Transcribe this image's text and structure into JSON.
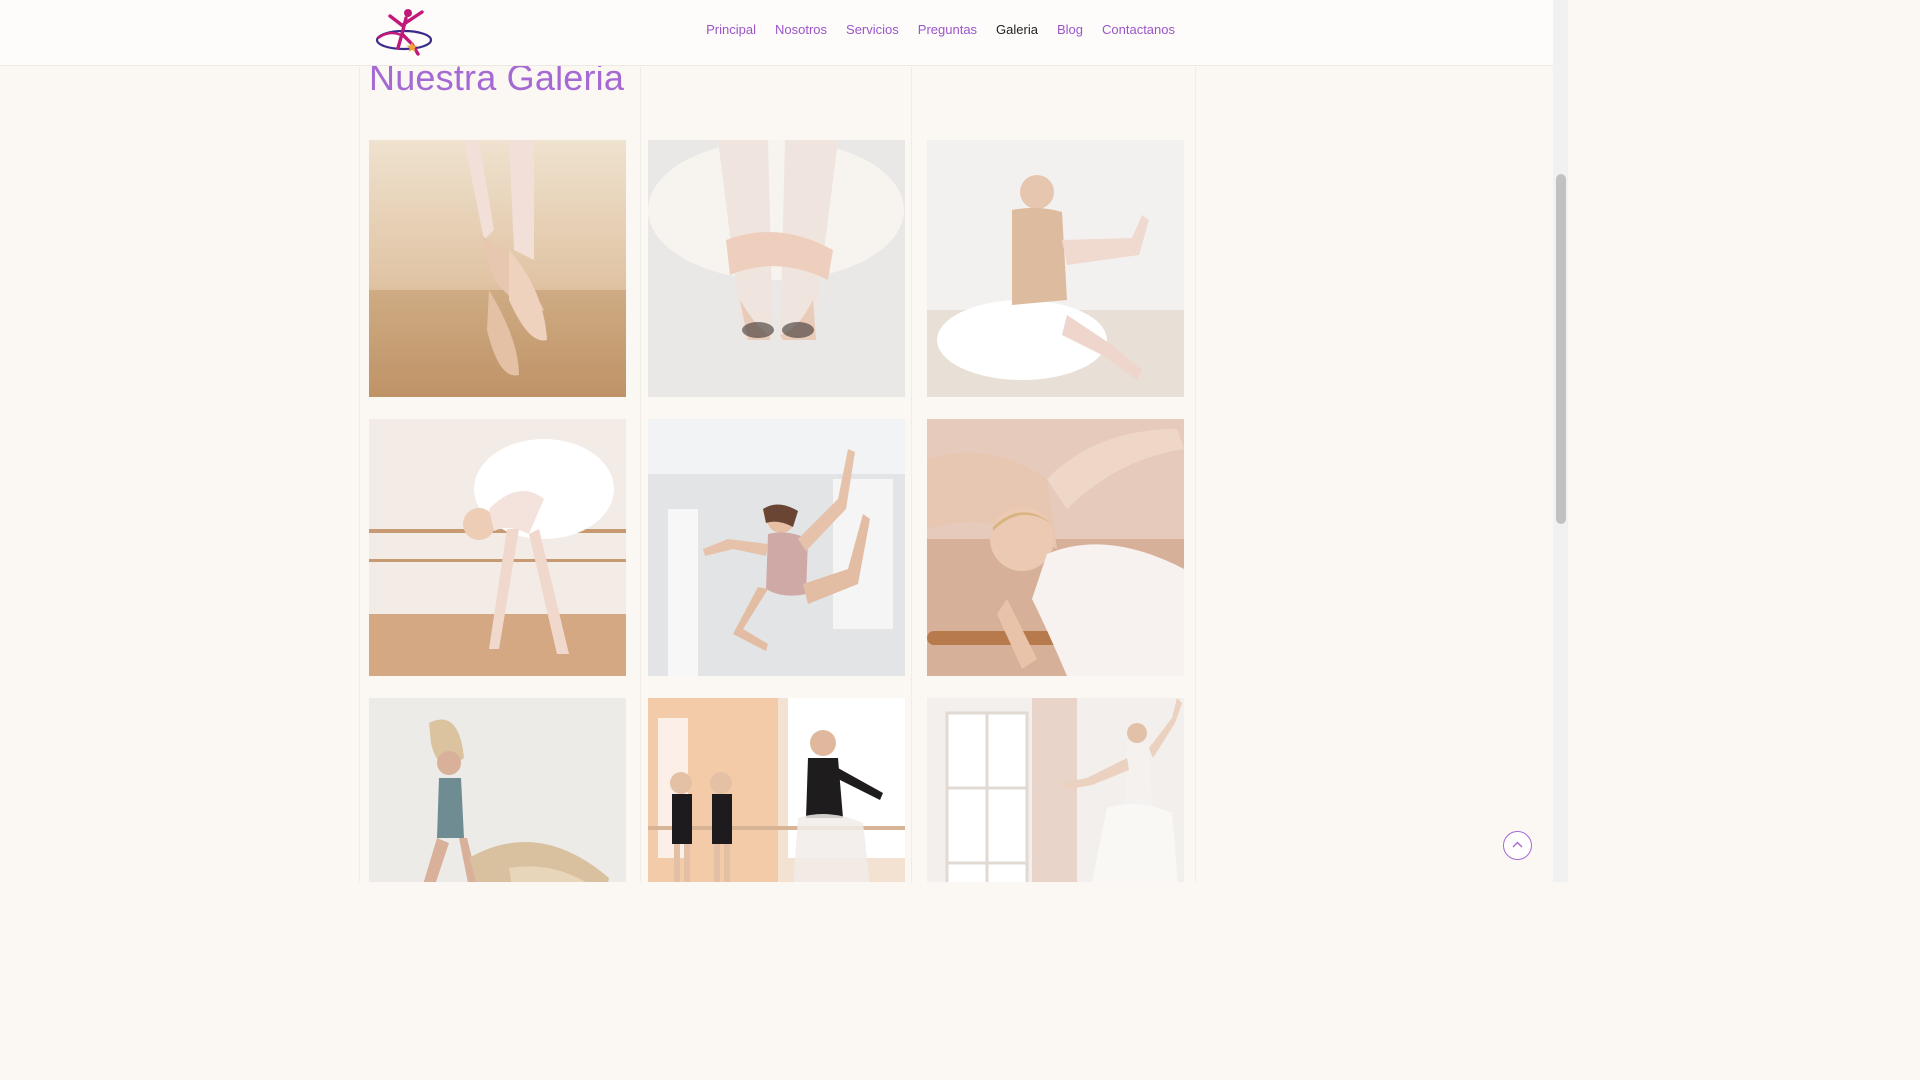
{
  "header": {
    "logo": {
      "icon": "ballerina-logo-icon",
      "colors": [
        "#c2187a",
        "#3a2a8c",
        "#f2a23a"
      ]
    },
    "nav": [
      {
        "label": "Principal",
        "active": false
      },
      {
        "label": "Nosotros",
        "active": false
      },
      {
        "label": "Servicios",
        "active": false
      },
      {
        "label": "Preguntas",
        "active": false
      },
      {
        "label": "Galeria",
        "active": true
      },
      {
        "label": "Blog",
        "active": false
      },
      {
        "label": "Contactanos",
        "active": false
      }
    ]
  },
  "main": {
    "title": "Nuestra Galeria",
    "gallery": [
      {
        "image": "ballet-pointe-shoes-photo"
      },
      {
        "image": "ballerina-seated-hands-on-shoes-photo"
      },
      {
        "image": "ballerina-stretching-leg-photo"
      },
      {
        "image": "ballerina-bending-at-barre-photo"
      },
      {
        "image": "dancer-jumping-photo"
      },
      {
        "image": "ballerina-stretching-at-barre-photo"
      },
      {
        "image": "dancer-with-flowing-fabric-photo"
      },
      {
        "image": "teacher-with-young-students-photo"
      },
      {
        "image": "ballerina-by-window-photo"
      }
    ]
  },
  "colors": {
    "accent": "#a569d4",
    "nav_link": "#9b55c9",
    "background": "#fbf8f4"
  },
  "scroll_to_top": {
    "icon": "chevron-up-icon"
  }
}
